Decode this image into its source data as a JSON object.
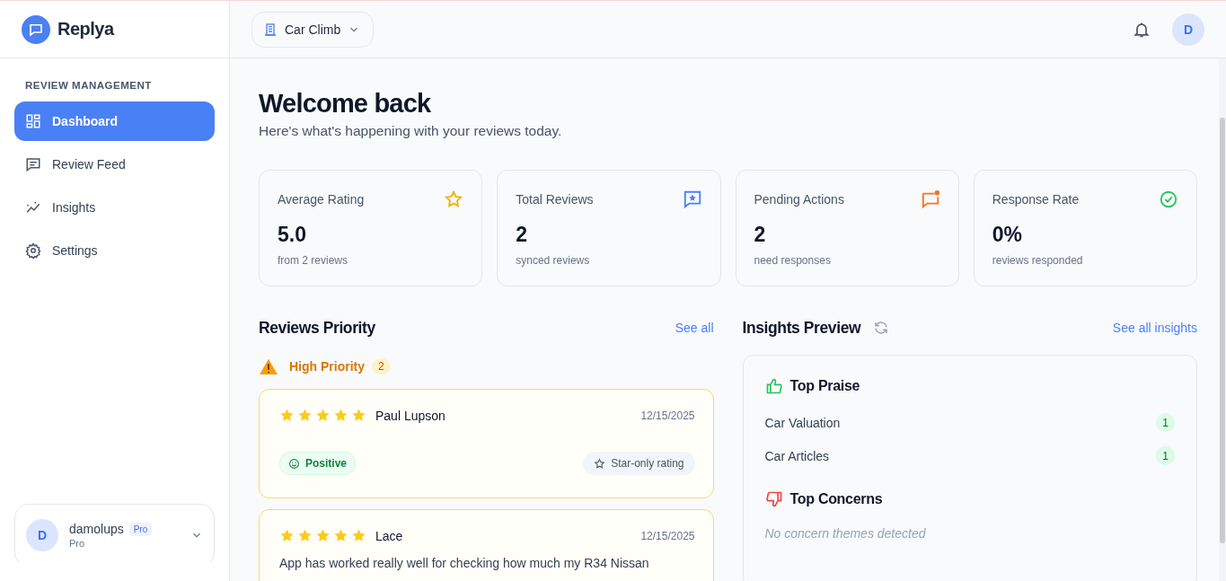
{
  "app": {
    "name": "Replya"
  },
  "sidebar": {
    "section_label": "REVIEW MANAGEMENT",
    "items": [
      {
        "label": "Dashboard",
        "kind": "dashboard",
        "selected": true
      },
      {
        "label": "Review Feed",
        "kind": "feed",
        "selected": false
      },
      {
        "label": "Insights",
        "kind": "insights",
        "selected": false
      },
      {
        "label": "Settings",
        "kind": "settings",
        "selected": false
      }
    ]
  },
  "user": {
    "initial": "D",
    "name": "damolups",
    "badge": "Pro",
    "plan": "Pro"
  },
  "header": {
    "business": "Car Climb",
    "avatar_initial": "D"
  },
  "welcome": {
    "title": "Welcome back",
    "subtitle": "Here's what's happening with your reviews today."
  },
  "stats": [
    {
      "label": "Average Rating",
      "value": "5.0",
      "note": "from 2 reviews",
      "kind": "rating"
    },
    {
      "label": "Total Reviews",
      "value": "2",
      "note": "synced reviews",
      "kind": "total"
    },
    {
      "label": "Pending Actions",
      "value": "2",
      "note": "need responses",
      "kind": "pending"
    },
    {
      "label": "Response Rate",
      "value": "0%",
      "note": "reviews responded",
      "kind": "rate"
    }
  ],
  "reviews_priority": {
    "title": "Reviews Priority",
    "link": "See all",
    "group": {
      "label": "High Priority",
      "count": "2"
    },
    "reviews": [
      {
        "stars": 5,
        "author": "Paul Lupson",
        "date": "12/15/2025",
        "sentiment": {
          "kind": "positive",
          "label": "Positive"
        },
        "tag": "Star-only rating"
      },
      {
        "stars": 5,
        "author": "Lace",
        "date": "12/15/2025",
        "text": "App has worked really well for checking how much my R34 Nissan"
      }
    ]
  },
  "insights_preview": {
    "title": "Insights Preview",
    "link": "See all insights",
    "sections": [
      {
        "kind": "praise",
        "title": "Top Praise",
        "items": [
          {
            "label": "Car Valuation",
            "count": "1"
          },
          {
            "label": "Car Articles",
            "count": "1"
          }
        ]
      },
      {
        "kind": "concerns",
        "title": "Top Concerns",
        "empty": "No concern themes detected"
      }
    ]
  }
}
